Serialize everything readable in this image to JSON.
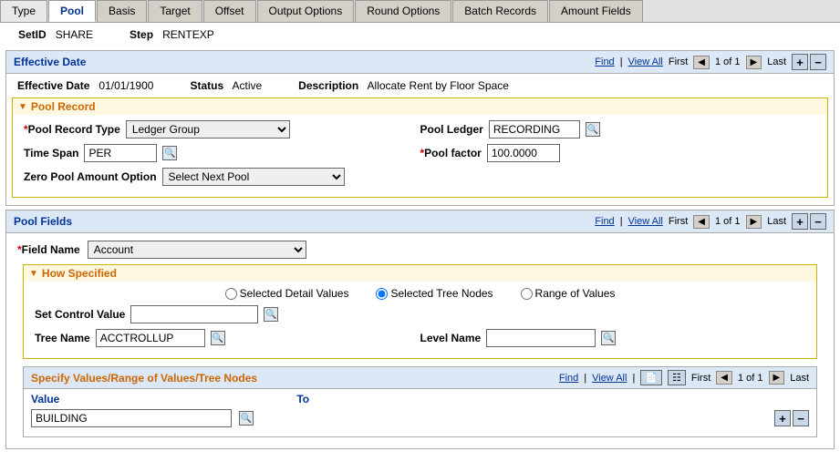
{
  "tabs": [
    {
      "id": "type",
      "label": "Type",
      "active": false
    },
    {
      "id": "pool",
      "label": "Pool",
      "active": true
    },
    {
      "id": "basis",
      "label": "Basis",
      "active": false
    },
    {
      "id": "target",
      "label": "Target",
      "active": false
    },
    {
      "id": "offset",
      "label": "Offset",
      "active": false
    },
    {
      "id": "output_options",
      "label": "Output Options",
      "active": false
    },
    {
      "id": "round_options",
      "label": "Round Options",
      "active": false
    },
    {
      "id": "batch_records",
      "label": "Batch Records",
      "active": false
    },
    {
      "id": "amount_fields",
      "label": "Amount Fields",
      "active": false
    }
  ],
  "header": {
    "setid_label": "SetID",
    "setid_value": "SHARE",
    "step_label": "Step",
    "step_value": "RENTEXP"
  },
  "effective_date_section": {
    "title": "Effective Date",
    "find_text": "Find",
    "view_all_text": "View All",
    "first_text": "First",
    "last_text": "Last",
    "nav_of": "1 of 1",
    "eff_date_label": "Effective Date",
    "eff_date_value": "01/01/1900",
    "status_label": "Status",
    "status_value": "Active",
    "description_label": "Description",
    "description_value": "Allocate Rent by Floor Space"
  },
  "pool_record": {
    "title": "Pool Record",
    "pool_record_type_label": "Pool Record Type",
    "pool_record_type_value": "Ledger Group",
    "pool_ledger_label": "Pool Ledger",
    "pool_ledger_value": "RECORDING",
    "time_span_label": "Time Span",
    "time_span_value": "PER",
    "pool_factor_label": "Pool factor",
    "pool_factor_value": "100.0000",
    "zero_pool_label": "Zero Pool Amount Option",
    "zero_pool_value": "Select Next Pool"
  },
  "pool_fields": {
    "title": "Pool Fields",
    "find_text": "Find",
    "view_all_text": "View All",
    "first_text": "First",
    "last_text": "Last",
    "nav_of": "1 of 1",
    "field_name_label": "Field Name",
    "field_name_value": "Account"
  },
  "how_specified": {
    "title": "How Specified",
    "radio_options": [
      {
        "id": "selected_detail",
        "label": "Selected Detail Values",
        "checked": false
      },
      {
        "id": "selected_tree",
        "label": "Selected Tree Nodes",
        "checked": true
      },
      {
        "id": "range_values",
        "label": "Range of Values",
        "checked": false
      }
    ],
    "set_control_label": "Set Control Value",
    "set_control_value": "",
    "tree_name_label": "Tree Name",
    "tree_name_value": "ACCTROLLUP",
    "level_name_label": "Level Name",
    "level_name_value": ""
  },
  "specify_values": {
    "title": "Specify Values/Range of Values/Tree Nodes",
    "find_text": "Find",
    "view_all_text": "View All",
    "first_text": "First",
    "last_text": "Last",
    "nav_of": "1 of 1",
    "col_value": "Value",
    "col_to": "To",
    "row_value": "BUILDING"
  }
}
